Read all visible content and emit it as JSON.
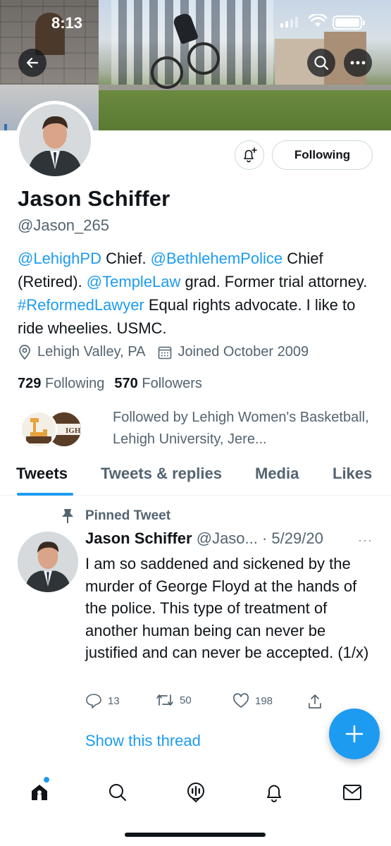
{
  "status_bar": {
    "time": "8:13"
  },
  "profile": {
    "name": "Jason Schiffer",
    "handle": "@Jason_265",
    "following_button": "Following",
    "bio": [
      {
        "text": "@LehighPD",
        "link": true
      },
      {
        "text": " Chief. ",
        "link": false
      },
      {
        "text": "@BethlehemPolice",
        "link": true
      },
      {
        "text": " Chief (Retired). ",
        "link": false
      },
      {
        "text": "@TempleLaw",
        "link": true
      },
      {
        "text": " grad. Former trial attorney. ",
        "link": false
      },
      {
        "text": "#ReformedLawyer",
        "link": true
      },
      {
        "text": " Equal rights advocate. I like to ride wheelies. USMC.",
        "link": false
      }
    ],
    "location": "Lehigh Valley, PA",
    "joined": "Joined October 2009",
    "following_count": "729",
    "following_label": "Following",
    "followers_count": "570",
    "followers_label": "Followers",
    "followed_by": "Followed by Lehigh Women's Basketball, Lehigh University, Jere..."
  },
  "tabs": [
    {
      "label": "Tweets",
      "active": true
    },
    {
      "label": "Tweets & replies",
      "active": false
    },
    {
      "label": "Media",
      "active": false
    },
    {
      "label": "Likes",
      "active": false
    }
  ],
  "tweet": {
    "pinned_label": "Pinned Tweet",
    "author_name": "Jason Schiffer",
    "author_meta": "@Jaso... · 5/29/20",
    "more": "···",
    "text": "I am so saddened and sickened by the murder of George Floyd at the hands of the police. This type of treatment of another human being can never be justified and can never be accepted. (1/x)",
    "replies": "13",
    "retweets": "50",
    "likes": "198",
    "show_thread": "Show this thread"
  },
  "colors": {
    "accent": "#1d9bf0",
    "text": "#0f1419",
    "muted": "#536471"
  },
  "icons": [
    "back-icon",
    "search-icon",
    "more-icon",
    "bell-plus-icon",
    "location-icon",
    "calendar-icon",
    "pin-icon",
    "reply-icon",
    "retweet-icon",
    "like-icon",
    "share-icon",
    "compose-icon",
    "home-icon",
    "explore-icon",
    "spaces-icon",
    "notifications-icon",
    "messages-icon"
  ]
}
